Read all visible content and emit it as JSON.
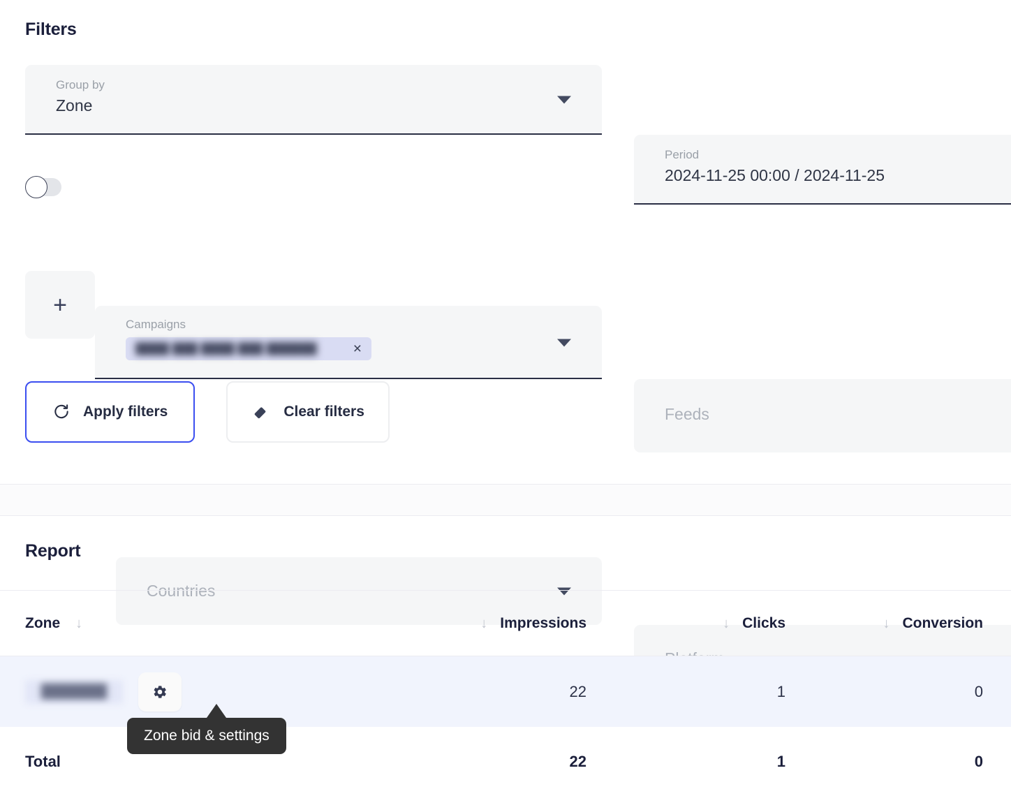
{
  "filters": {
    "title": "Filters",
    "group_by": {
      "label": "Group by",
      "value": "Zone"
    },
    "period": {
      "label": "Period",
      "value": "2024-11-25 00:00 / 2024-11-25"
    },
    "campaigns": {
      "label": "Campaigns",
      "chip_text": "████ ███ ████ ███ ██████",
      "remove_label": "×"
    },
    "feeds": {
      "placeholder": "Feeds"
    },
    "countries": {
      "placeholder": "Countries"
    },
    "platform": {
      "placeholder": "Platform"
    },
    "add_button_label": "+",
    "toggle_state": "off",
    "apply_button": "Apply filters",
    "clear_button": "Clear filters"
  },
  "report": {
    "title": "Report",
    "columns": [
      {
        "label": "Zone",
        "sort_icon": "↓"
      },
      {
        "label": "Impressions",
        "sort_icon": "↓"
      },
      {
        "label": "Clicks",
        "sort_icon": "↓"
      },
      {
        "label": "Conversion",
        "sort_icon": "↓"
      }
    ],
    "rows": [
      {
        "zone": "███████",
        "impressions": "22",
        "clicks": "1",
        "conversion": "0"
      }
    ],
    "total": {
      "label": "Total",
      "impressions": "22",
      "clicks": "1",
      "conversion": "0"
    },
    "tooltip": "Zone bid & settings"
  },
  "colors": {
    "accent": "#3b4ef0",
    "text": "#1b1f3b",
    "field_bg": "#f5f6f7",
    "row_highlight": "#f1f4fd",
    "tooltip_bg": "#333333",
    "chip_bg": "#d9dcf3"
  }
}
